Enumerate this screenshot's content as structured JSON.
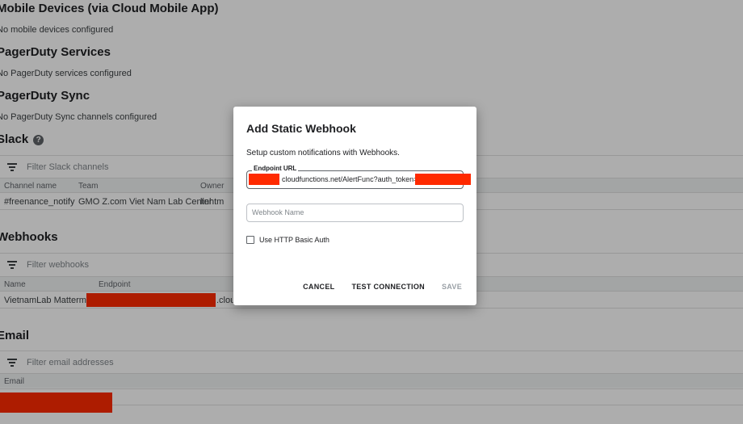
{
  "sections": {
    "mobile": {
      "title": "Mobile Devices (via Cloud Mobile App)",
      "empty": "No mobile devices configured"
    },
    "pagerduty_services": {
      "title": "PagerDuty Services",
      "empty": "No PagerDuty services configured"
    },
    "pagerduty_sync": {
      "title": "PagerDuty Sync",
      "empty": "No PagerDuty Sync channels configured"
    },
    "slack": {
      "title": "Slack",
      "help_icon": "help-circle-icon",
      "filter_placeholder": "Filter Slack channels",
      "columns": [
        "Channel name",
        "Team",
        "Owner"
      ],
      "rows": [
        {
          "channel": "#freenance_notify",
          "team": "GMO Z.com Viet Nam Lab Center",
          "owner": "linhtm"
        }
      ]
    },
    "webhooks": {
      "title": "Webhooks",
      "filter_placeholder": "Filter webhooks",
      "columns": [
        "Name",
        "Endpoint"
      ],
      "rows": [
        {
          "name": "VietnamLab Mattermost",
          "endpoint_suffix": ".cloud"
        }
      ]
    },
    "email": {
      "title": "Email",
      "filter_placeholder": "Filter email addresses",
      "columns": [
        "Email"
      ]
    }
  },
  "dialog": {
    "title": "Add Static Webhook",
    "description": "Setup custom notifications with Webhooks.",
    "endpoint_label": "Endpoint URL",
    "endpoint_value": "cloudfunctions.net/AlertFunc?auth_token=",
    "webhook_name_placeholder": "Webhook Name",
    "basic_auth_label": "Use HTTP Basic Auth",
    "basic_auth_checked": false,
    "buttons": {
      "cancel": "CANCEL",
      "test": "TEST CONNECTION",
      "save": "SAVE"
    }
  },
  "colors": {
    "redaction": "#ff2a00",
    "scrim": "rgba(0,0,0,0.32)"
  }
}
